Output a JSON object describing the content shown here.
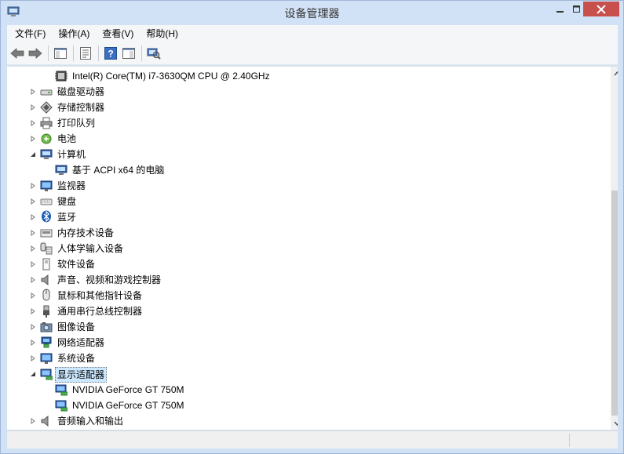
{
  "window": {
    "title": "设备管理器",
    "colors": {
      "frame": "#d2e2f6",
      "close_button": "#c7504c",
      "selection": "#cce8ff"
    }
  },
  "menu": {
    "file": "文件(F)",
    "action": "操作(A)",
    "view": "查看(V)",
    "help": "帮助(H)"
  },
  "toolbar": {
    "buttons": [
      "back-arrow-icon",
      "forward-arrow-icon",
      "show-hide-tree-icon",
      "properties-icon",
      "help-icon",
      "action-pane-icon",
      "scan-hardware-icon"
    ]
  },
  "tree": {
    "cpu": "Intel(R) Core(TM) i7-3630QM CPU @ 2.40GHz",
    "disk_drives": "磁盘驱动器",
    "storage_controllers": "存储控制器",
    "print_queues": "打印队列",
    "battery": "电池",
    "computer": "计算机",
    "computer_child": "基于 ACPI x64 的电脑",
    "monitors": "监视器",
    "keyboards": "键盘",
    "bluetooth": "蓝牙",
    "memory_tech": "内存技术设备",
    "hid": "人体学输入设备",
    "software_devices": "软件设备",
    "sound_video_game": "声音、视频和游戏控制器",
    "mice": "鼠标和其他指针设备",
    "usb": "通用串行总线控制器",
    "imaging": "图像设备",
    "network": "网络适配器",
    "system": "系统设备",
    "display": "显示适配器",
    "gpu1": "NVIDIA GeForce GT 750M",
    "gpu2": "NVIDIA GeForce GT 750M",
    "audio_io": "音频输入和输出"
  }
}
